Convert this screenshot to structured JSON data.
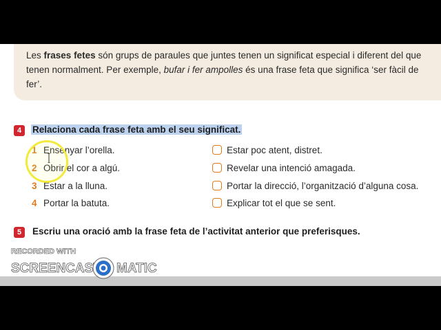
{
  "intro": {
    "p1": "Les ",
    "term": "frases fetes",
    "p2": " són grups de paraules que juntes tenen un significat especial i diferent del que tenen normalment. Per exemple, ",
    "example": "bufar i fer ampolles",
    "p3": " és una frase feta que significa ‘ser fàcil de fer’."
  },
  "exercise4": {
    "number": "4",
    "instruction": "Relaciona cada frase feta amb el seu significat.",
    "phrases": [
      {
        "num": "1",
        "text": "Ensenyar l’orella."
      },
      {
        "num": "2",
        "text": "Obrir el cor a algú."
      },
      {
        "num": "3",
        "text": "Estar a la lluna."
      },
      {
        "num": "4",
        "text": "Portar la batuta."
      }
    ],
    "meanings": [
      "Estar poc atent, distret.",
      "Revelar una intenció amagada.",
      "Portar la direcció, l’organització d’alguna cosa.",
      "Explicar tot el que se sent."
    ]
  },
  "exercise5": {
    "number": "5",
    "instruction": "Escriu una oració amb la frase feta de l’activitat anterior que preferisques."
  },
  "watermark": {
    "line1": "RECORDED WITH",
    "brand_left": "SCREENCAST",
    "brand_right": "MATIC"
  },
  "colors": {
    "exercise_badge": "#d0262f",
    "phrase_number": "#e07b1f",
    "info_box": "#f4ece0",
    "highlight": "#bcd2ee",
    "cursor_ring": "#f2ea3c",
    "watermark_blue": "#2a6fc9"
  },
  "icons": {
    "cursor": "text-cursor-icon",
    "checkbox": "empty-checkbox-icon",
    "watermark_logo": "screencast-o-matic-logo-icon"
  }
}
